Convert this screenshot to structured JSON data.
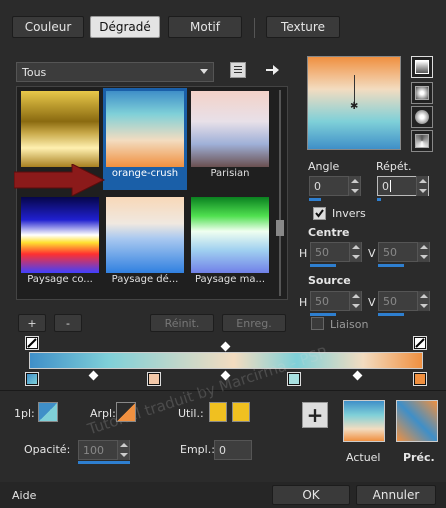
{
  "tabs": [
    {
      "label": "Couleur"
    },
    {
      "label": "Dégradé"
    },
    {
      "label": "Motif"
    },
    {
      "label": "Texture"
    }
  ],
  "category_dropdown": {
    "value": "Tous"
  },
  "presets": [
    {
      "label": ""
    },
    {
      "label": "orange-crush"
    },
    {
      "label": "Parisian"
    },
    {
      "label": "Paysage co..."
    },
    {
      "label": "Paysage dé..."
    },
    {
      "label": "Paysage ma..."
    }
  ],
  "buttons": {
    "add": "+",
    "remove": "-",
    "reset": "Réinit.",
    "save": "Enreg.",
    "ok": "OK",
    "cancel": "Annuler",
    "help": "Aide"
  },
  "angle": {
    "label": "Angle",
    "value": "0"
  },
  "repeat": {
    "label": "Répét.",
    "value": "0"
  },
  "invert": {
    "label": "Invers",
    "checked": true
  },
  "center": {
    "label": "Centre",
    "h_label": "H",
    "h_value": "50",
    "v_label": "V",
    "v_value": "50"
  },
  "source": {
    "label": "Source",
    "h_label": "H",
    "h_value": "50",
    "v_label": "V",
    "v_value": "50"
  },
  "link": {
    "label": "Liaison",
    "checked": false
  },
  "stops_panel": {
    "first_plan_label": "1pl:",
    "arpl_label": "Arpl:",
    "util_label": "Util.:",
    "opacity_label": "Opacité:",
    "opacity_value": "100",
    "empl_label": "Empl.:",
    "empl_value": "0"
  },
  "previews": {
    "current_label": "Actuel",
    "previous_label": "Préc."
  },
  "watermark": "Tutoriel traduit by Marcirma - PSP",
  "colors": {
    "accent": "#2e7fd0",
    "arrow": "#8b1a1a",
    "gradient_orange": "#f09040",
    "gradient_cream": "#f3dcc0",
    "gradient_teal": "#7fd0d8",
    "gradient_blue": "#3f8fc8",
    "util_yellow": "#f0c020"
  },
  "icons": {
    "library": "book-icon",
    "export": "right-arrow-icon",
    "add_stop": "plus-icon"
  }
}
